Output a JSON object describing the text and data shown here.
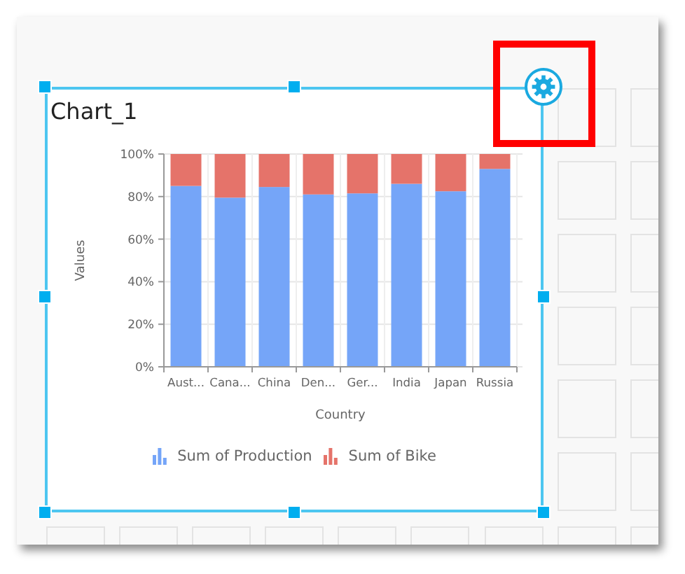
{
  "widget": {
    "title": "Chart_1",
    "selected": true
  },
  "chart_data": {
    "type": "bar",
    "stacked": true,
    "grid": true,
    "xlabel": "Country",
    "ylabel": "Values",
    "categories": [
      "Aust...",
      "Cana...",
      "China",
      "Den...",
      "Ger...",
      "India",
      "Japan",
      "Russia"
    ],
    "ylim": [
      0,
      100
    ],
    "yticks": [
      {
        "value": 0,
        "label": "0%"
      },
      {
        "value": 20,
        "label": "20%"
      },
      {
        "value": 40,
        "label": "40%"
      },
      {
        "value": 60,
        "label": "60%"
      },
      {
        "value": 80,
        "label": "80%"
      },
      {
        "value": 100,
        "label": "100%"
      }
    ],
    "series": [
      {
        "name": "Sum of Production",
        "color": "#75a5f8",
        "values": [
          85,
          79.5,
          84.5,
          81,
          81.5,
          86,
          82.5,
          93
        ]
      },
      {
        "name": "Sum of Bike",
        "color": "#e5736a",
        "values": [
          15,
          20.5,
          15.5,
          19,
          18.5,
          14,
          17.5,
          7
        ]
      }
    ]
  },
  "highlight": {
    "shown": true
  }
}
